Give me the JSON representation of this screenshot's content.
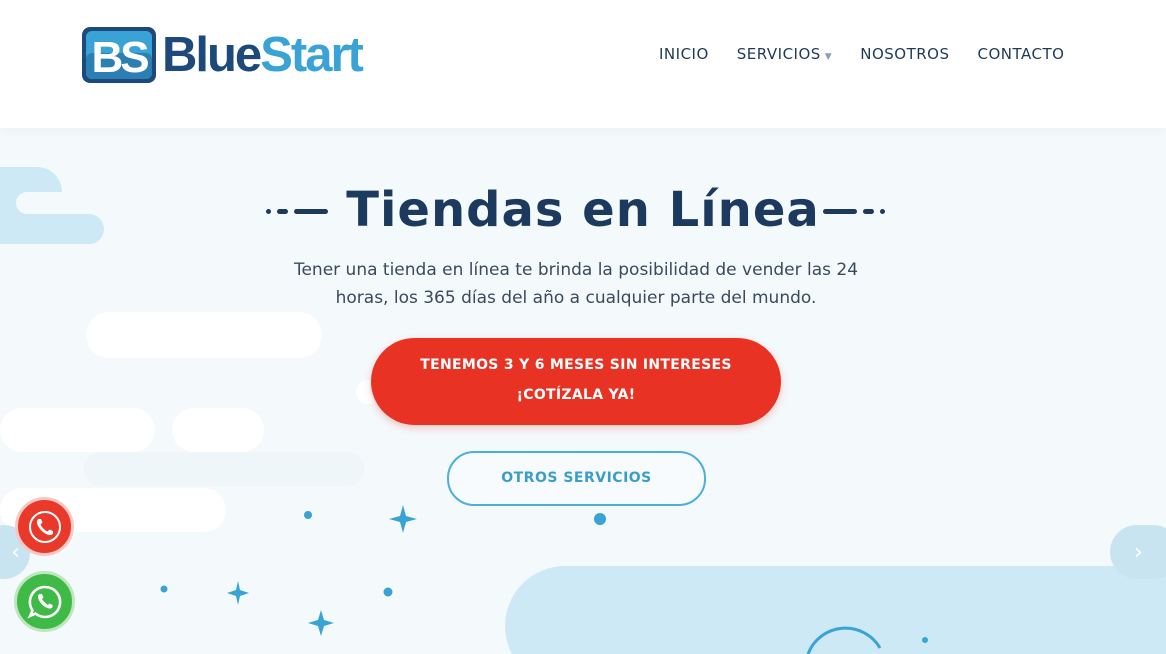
{
  "brand": {
    "logo_monogram": "BS",
    "name_part1": "Blue",
    "name_part2": "Start",
    "colors": {
      "dark_blue": "#1d4a7a",
      "light_blue": "#3aa3d6"
    }
  },
  "nav": {
    "items": [
      {
        "label": "INICIO"
      },
      {
        "label": "SERVICIOS",
        "has_dropdown": true
      },
      {
        "label": "NOSOTROS"
      },
      {
        "label": "CONTACTO"
      }
    ]
  },
  "hero": {
    "title": "Tiendas en Línea",
    "subtitle": "Tener una tienda en línea te brinda la posibilidad de vender las 24 horas, los 365 días del año a cualquier parte del mundo.",
    "cta": {
      "line1": "TENEMOS 3 Y 6 MESES SIN INTERESES",
      "line2": "¡COTÍZALA YA!",
      "color": "#e83224"
    },
    "secondary_button": "OTROS SERVICIOS"
  },
  "floating": {
    "phone_icon": "phone-icon",
    "whatsapp_icon": "whatsapp-icon"
  },
  "slider": {
    "prev_icon": "chevron-left-icon",
    "next_icon": "chevron-right-icon",
    "prev_glyph": "‹",
    "next_glyph": "›"
  }
}
